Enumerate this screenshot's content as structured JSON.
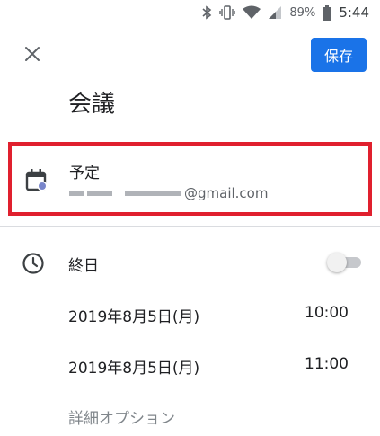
{
  "status_bar": {
    "icons": [
      "bluetooth-icon",
      "vibrate-icon",
      "wifi-icon",
      "cell-signal-icon",
      "battery-icon"
    ],
    "battery": "89%",
    "time": "5:44"
  },
  "toolbar": {
    "close_icon": "close-icon",
    "save_label": "保存"
  },
  "event": {
    "title": "会議"
  },
  "calendar": {
    "label": "予定",
    "account_suffix": "@gmail.com",
    "icon": "calendar-icon"
  },
  "all_day": {
    "label": "終日",
    "enabled": false,
    "icon": "clock-icon"
  },
  "start": {
    "date": "2019年8月5日(月)",
    "time": "10:00"
  },
  "end": {
    "date": "2019年8月5日(月)",
    "time": "11:00"
  },
  "more_options_label": "詳細オプション",
  "colors": {
    "primary": "#1a73e8",
    "highlight": "#e0202e",
    "calendar_dot": "#7986cb"
  }
}
